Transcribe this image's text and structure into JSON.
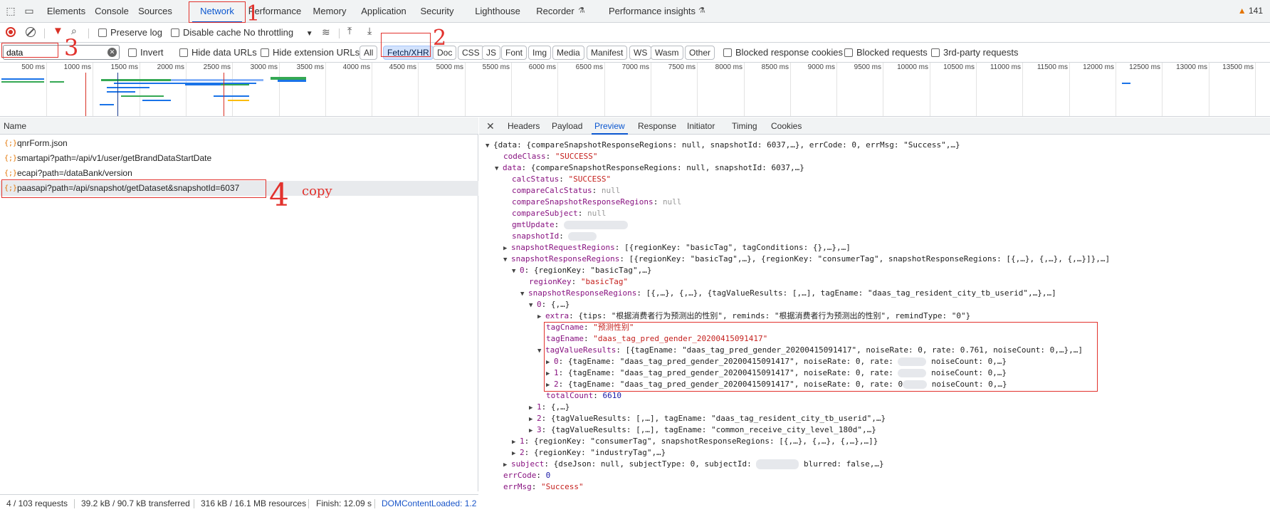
{
  "tabs": {
    "items": [
      "Elements",
      "Console",
      "Sources",
      "Network",
      "Performance",
      "Memory",
      "Application",
      "Security",
      "Lighthouse",
      "Recorder",
      "Performance insights"
    ],
    "active": "Network",
    "warning_count": "141"
  },
  "toolbar": {
    "preserve_log": "Preserve log",
    "disable_cache": "Disable cache",
    "throttling": "No throttling"
  },
  "filter": {
    "value": "data",
    "invert": "Invert",
    "hide_data_urls": "Hide data URLs",
    "hide_extension_urls": "Hide extension URLs",
    "types": [
      "All",
      "Fetch/XHR",
      "Doc",
      "CSS",
      "JS",
      "Font",
      "Img",
      "Media",
      "Manifest",
      "WS",
      "Wasm",
      "Other"
    ],
    "selected_type": "Fetch/XHR",
    "blocked_response_cookies": "Blocked response cookies",
    "blocked_requests": "Blocked requests",
    "third_party": "3rd-party requests"
  },
  "timeline": {
    "ticks": [
      "500 ms",
      "1000 ms",
      "1500 ms",
      "2000 ms",
      "2500 ms",
      "3000 ms",
      "3500 ms",
      "4000 ms",
      "4500 ms",
      "5000 ms",
      "5500 ms",
      "6000 ms",
      "6500 ms",
      "7000 ms",
      "7500 ms",
      "8000 ms",
      "8500 ms",
      "9000 ms",
      "9500 ms",
      "10000 ms",
      "10500 ms",
      "11000 ms",
      "11500 ms",
      "12000 ms",
      "12500 ms",
      "13000 ms",
      "13500 ms"
    ]
  },
  "requests": {
    "header": "Name",
    "items": [
      "qnrForm.json",
      "smartapi?path=/api/v1/user/getBrandDataStartDate",
      "ecapi?path=/dataBank/version",
      "paasapi?path=/api/snapshot/getDataset&snapshotId=6037"
    ],
    "selected_index": 3
  },
  "status": {
    "requests": "4 / 103 requests",
    "transferred": "39.2 kB / 90.7 kB transferred",
    "resources": "316 kB / 16.1 MB resources",
    "finish": "Finish: 12.09 s",
    "dcl": "DOMContentLoaded: 1.2"
  },
  "detail_tabs": {
    "items": [
      "Headers",
      "Payload",
      "Preview",
      "Response",
      "Initiator",
      "Timing",
      "Cookies"
    ],
    "active": "Preview"
  },
  "preview": {
    "l0": "{data: {compareSnapshotResponseRegions: null, snapshotId: 6037,…}, errCode: 0, errMsg: \"Success\",…}",
    "codeClass_k": "codeClass",
    "codeClass_v": "\"SUCCESS\"",
    "data_k": "data",
    "data_v": "{compareSnapshotResponseRegions: null, snapshotId: 6037,…}",
    "calcStatus_k": "calcStatus",
    "calcStatus_v": "\"SUCCESS\"",
    "compareCalcStatus_k": "compareCalcStatus",
    "compareSnapshotResponseRegions_k": "compareSnapshotResponseRegions",
    "compareSubject_k": "compareSubject",
    "null_v": "null",
    "gmtUpdate_k": "gmtUpdate",
    "snapshotId_k": "snapshotId",
    "snapshotRequestRegions_k": "snapshotRequestRegions",
    "snapshotRequestRegions_v": "[{regionKey: \"basicTag\", tagConditions: {},…},…]",
    "snapshotResponseRegions_k": "snapshotResponseRegions",
    "snapshotResponseRegions_v": "[{regionKey: \"basicTag\",…}, {regionKey: \"consumerTag\", snapshotResponseRegions: [{,…}, {,…}, {,…}]},…]",
    "r0_k": "0",
    "r0_v": "{regionKey: \"basicTag\",…}",
    "regionKey_k": "regionKey",
    "regionKey_v": "\"basicTag\"",
    "inner_k": "snapshotResponseRegions",
    "inner_v": "[{,…}, {,…}, {tagValueResults: [,…], tagEname: \"daas_tag_resident_city_tb_userid\",…},…]",
    "i0_k": "0",
    "i0_v": "{,…}",
    "extra_k": "extra",
    "extra_v": "{tips: \"根据消费者行为预测出的性别\", reminds: \"根据消费者行为预测出的性别\", remindType: \"0\"}",
    "tagCname_k": "tagCname",
    "tagCname_v": "\"预测性别\"",
    "tagEname_k": "tagEname",
    "tagEname_v": "\"daas_tag_pred_gender_20200415091417\"",
    "tvr_k": "tagValueResults",
    "tvr_v": "[{tagEname: \"daas_tag_pred_gender_20200415091417\", noiseRate: 0, rate: 0.761, noiseCount: 0,…},…]",
    "t0_k": "0",
    "t0_v": "{tagEname: \"daas_tag_pred_gender_20200415091417\", noiseRate: 0, rate:",
    "t0_tail": "noiseCount: 0,…}",
    "t1_k": "1",
    "t1_v": "{tagEname: \"daas_tag_pred_gender_20200415091417\", noiseRate: 0, rate:",
    "t1_tail": "noiseCount: 0,…}",
    "t2_k": "2",
    "t2_v": "{tagEname: \"daas_tag_pred_gender_20200415091417\", noiseRate: 0, rate: 0",
    "t2_tail": "noiseCount: 0,…}",
    "totalCount_k": "totalCount",
    "totalCount_v": "6610",
    "i1_k": "1",
    "i1_v": "{,…}",
    "i2_k": "2",
    "i2_v": "{tagValueResults: [,…], tagEname: \"daas_tag_resident_city_tb_userid\",…}",
    "i3_k": "3",
    "i3_v": "{tagValueResults: [,…], tagEname: \"common_receive_city_level_180d\",…}",
    "r1_k": "1",
    "r1_v": "{regionKey: \"consumerTag\", snapshotResponseRegions: [{,…}, {,…}, {,…},…]}",
    "r2_k": "2",
    "r2_v": "{regionKey: \"industryTag\",…}",
    "subject_k": "subject",
    "subject_v": "{dseJson: null, subjectType: 0, subjectId:",
    "subject_tail": "blurred: false,…}",
    "errCode_k": "errCode",
    "errCode_v": "0",
    "errMsg_k": "errMsg",
    "errMsg_v": "\"Success\""
  },
  "annotations": {
    "n1": "1",
    "n2": "2",
    "n3": "3",
    "n4": "4",
    "copy": "copy"
  },
  "colors": {
    "accent": "#0b57d0",
    "annotation_red": "#e2322d",
    "json_key": "#881280",
    "json_string": "#c5221f",
    "json_number": "#1a1aa6"
  }
}
